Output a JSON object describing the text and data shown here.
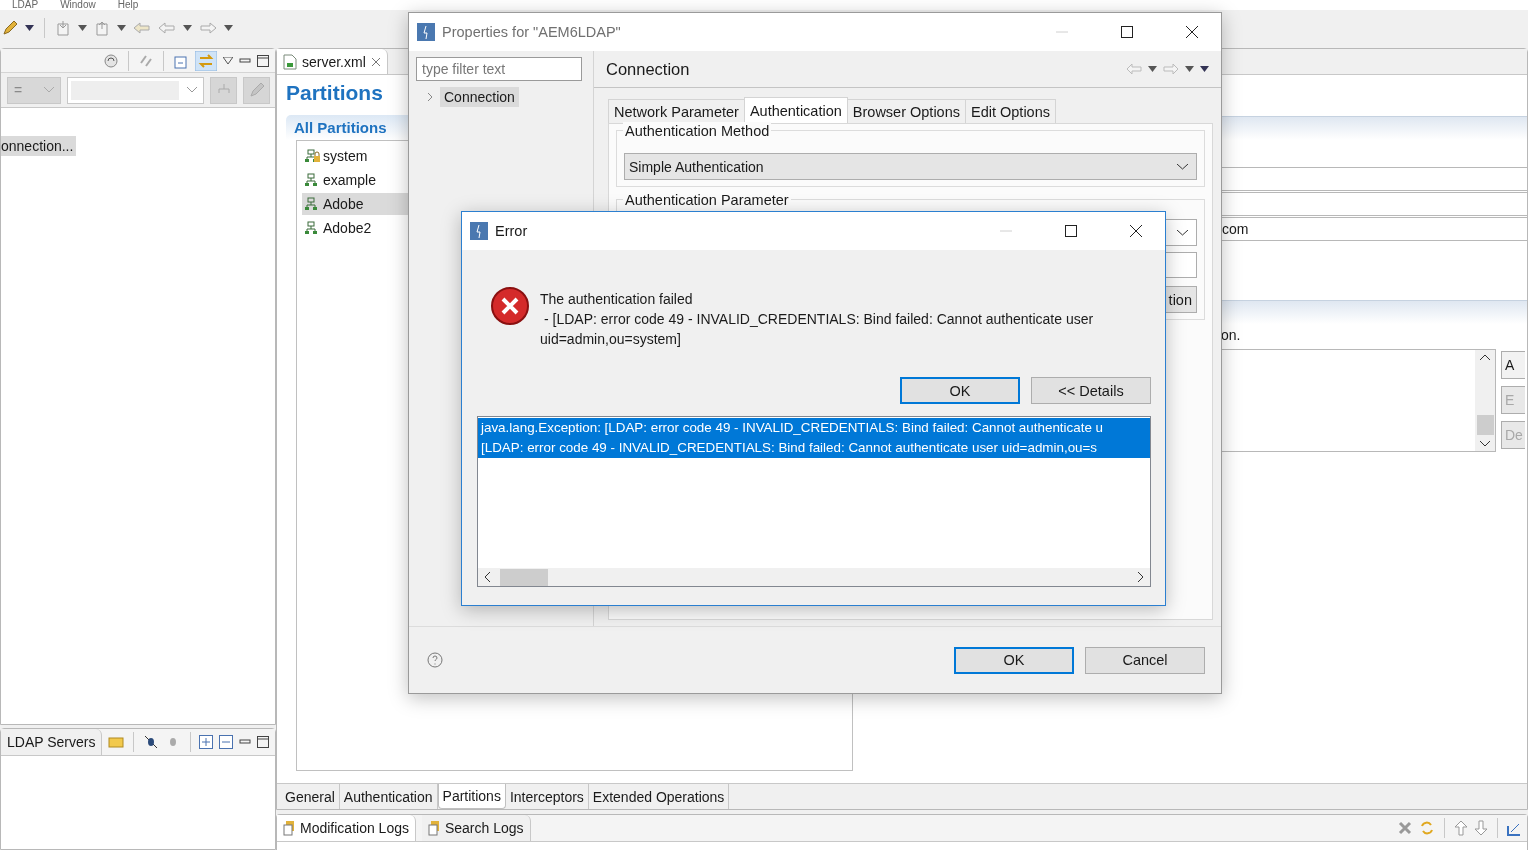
{
  "menu": [
    {
      "label": "LDAP"
    },
    {
      "label": "Window"
    },
    {
      "label": "Help"
    }
  ],
  "connections_view": {
    "operator": "=",
    "items": [
      {
        "label": "onnection...",
        "selected": true
      }
    ]
  },
  "servers_view": {
    "tab": "LDAP Servers"
  },
  "editor": {
    "tab": "server.xml",
    "title": "Partitions",
    "section": "All Partitions",
    "partitions": [
      {
        "label": "system",
        "locked": true,
        "selected": false
      },
      {
        "label": "example",
        "locked": false,
        "selected": false
      },
      {
        "label": "Adobe",
        "locked": false,
        "selected": true
      },
      {
        "label": "Adobe2",
        "locked": false,
        "selected": false
      }
    ],
    "suffix_value": "com",
    "description": "on.",
    "side_buttons": [
      {
        "label": "A",
        "disabled": false
      },
      {
        "label": "E",
        "disabled": true
      },
      {
        "label": "De",
        "disabled": true
      }
    ],
    "pages": [
      {
        "label": "General",
        "selected": false
      },
      {
        "label": "Authentication",
        "selected": false
      },
      {
        "label": "Partitions",
        "selected": true
      },
      {
        "label": "Interceptors",
        "selected": false
      },
      {
        "label": "Extended Operations",
        "selected": false
      }
    ]
  },
  "logs_view": {
    "tabs": [
      {
        "label": "Modification Logs",
        "selected": true
      },
      {
        "label": "Search Logs",
        "selected": false
      }
    ]
  },
  "properties_dialog": {
    "title": "Properties for \"AEM6LDAP\"",
    "filter_placeholder": "type filter text",
    "tree": [
      {
        "label": "Connection",
        "selected": true,
        "expanded": false
      }
    ],
    "page_title": "Connection",
    "tabs": [
      {
        "label": "Network Parameter",
        "selected": false
      },
      {
        "label": "Authentication",
        "selected": true
      },
      {
        "label": "Browser Options",
        "selected": false
      },
      {
        "label": "Edit Options",
        "selected": false
      }
    ],
    "method_group": "Authentication Method",
    "method_value": "Simple Authentication",
    "parameter_group": "Authentication Parameter",
    "parameter_button": "tion",
    "buttons": [
      {
        "label": "OK",
        "default": true
      },
      {
        "label": "Cancel",
        "default": false
      }
    ]
  },
  "error_dialog": {
    "title": "Error",
    "message": "The authentication failed",
    "detail": "- [LDAP: error code 49 - INVALID_CREDENTIALS: Bind failed: Cannot authenticate user uid=admin,ou=system]",
    "buttons": [
      {
        "label": "OK",
        "default": true
      },
      {
        "label": "<< Details",
        "default": false
      }
    ],
    "details": [
      {
        "text": "java.lang.Exception: [LDAP: error code 49 - INVALID_CREDENTIALS: Bind failed: Cannot authenticate u",
        "selected": true
      },
      {
        "text": "[LDAP: error code 49 - INVALID_CREDENTIALS: Bind failed: Cannot authenticate user uid=admin,ou=s",
        "selected": true
      }
    ]
  }
}
